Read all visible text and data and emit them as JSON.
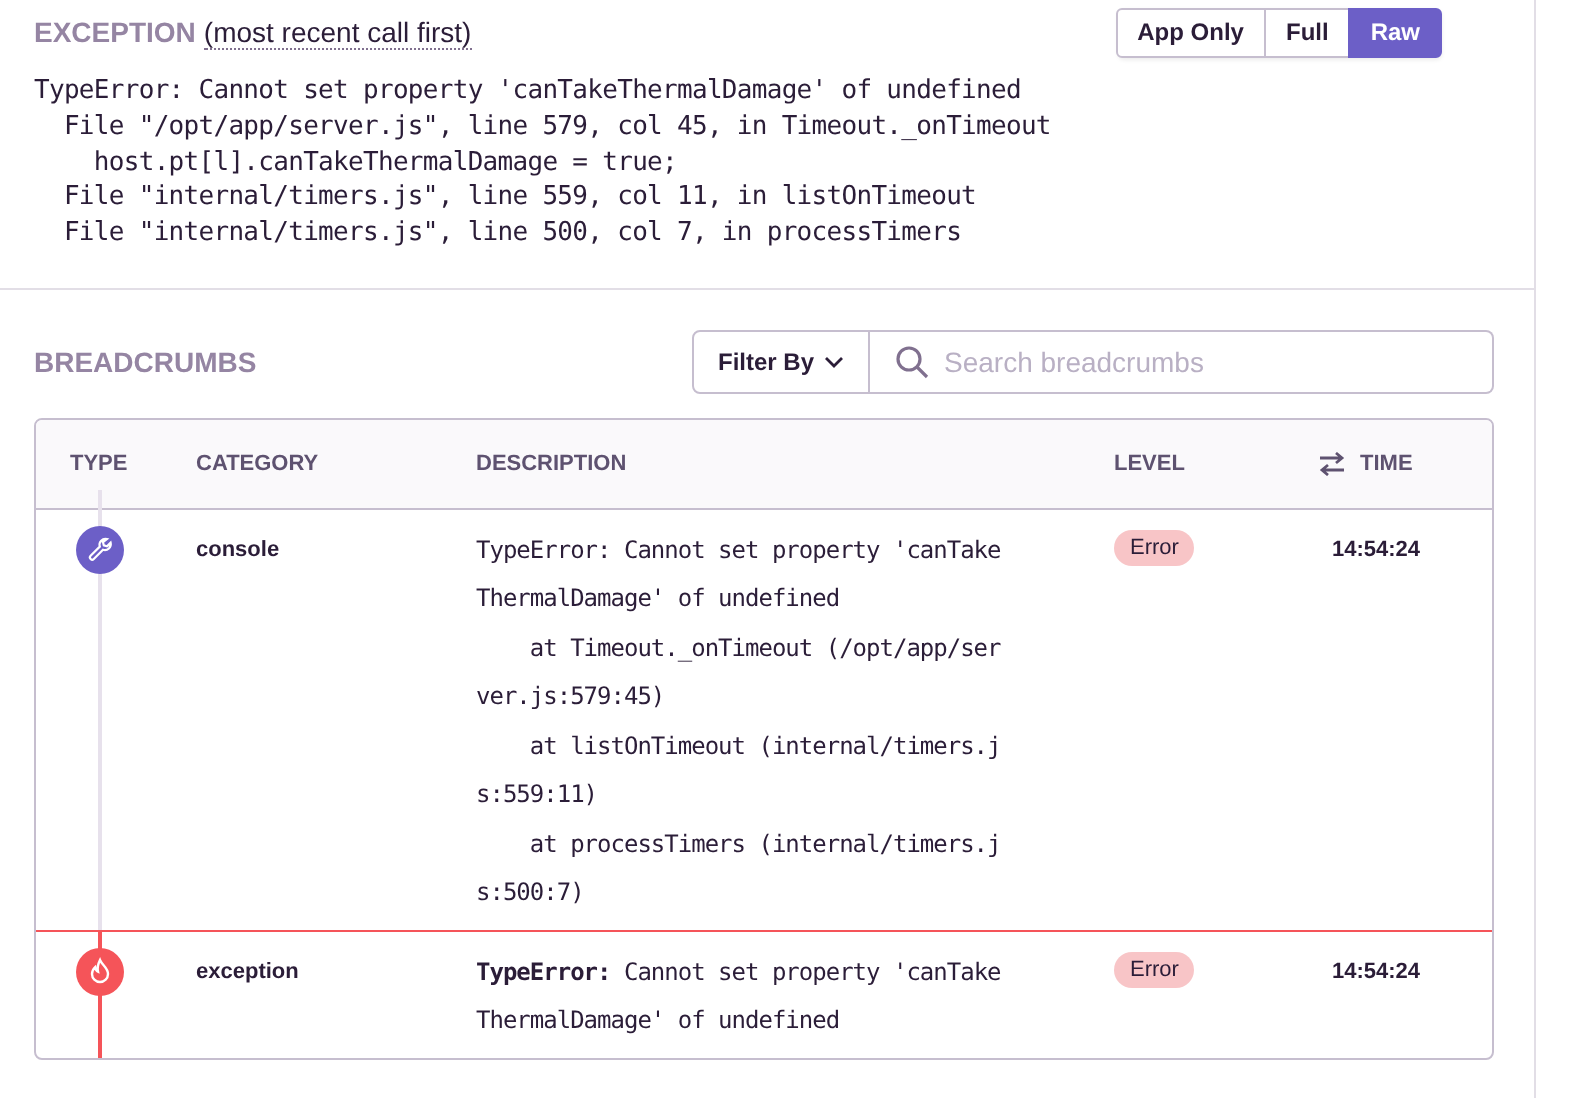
{
  "exception": {
    "title": "EXCEPTION",
    "subtitle": "(most recent call first)",
    "views": [
      {
        "label": "App Only",
        "selected": false
      },
      {
        "label": "Full",
        "selected": false
      },
      {
        "label": "Raw",
        "selected": true
      }
    ],
    "trace": [
      "TypeError: Cannot set property 'canTakeThermalDamage' of undefined",
      "  File \"/opt/app/server.js\", line 579, col 45, in Timeout._onTimeout",
      "    host.pt[l].canTakeThermalDamage = true;",
      "  File \"internal/timers.js\", line 559, col 11, in listOnTimeout",
      "  File \"internal/timers.js\", line 500, col 7, in processTimers"
    ]
  },
  "breadcrumbs": {
    "title": "BREADCRUMBS",
    "filter_label": "Filter By",
    "search": {
      "placeholder": "Search breadcrumbs"
    },
    "columns": [
      "TYPE",
      "CATEGORY",
      "DESCRIPTION",
      "LEVEL",
      "TIME"
    ],
    "rows": [
      {
        "kind": "console",
        "category": "console",
        "description": [
          "TypeError: Cannot set property 'canTake",
          "ThermalDamage' of undefined",
          "    at Timeout._onTimeout (/opt/app/ser",
          "ver.js:579:45)",
          "    at listOnTimeout (internal/timers.j",
          "s:559:11)",
          "    at processTimers (internal/timers.j",
          "s:500:7)"
        ],
        "level": "Error",
        "time": "14:54:24"
      },
      {
        "kind": "exception",
        "category": "exception",
        "description": [
          "**TypeError:** Cannot set property 'canTake",
          "ThermalDamage' of undefined"
        ],
        "level": "Error",
        "time": "14:54:24"
      }
    ]
  }
}
